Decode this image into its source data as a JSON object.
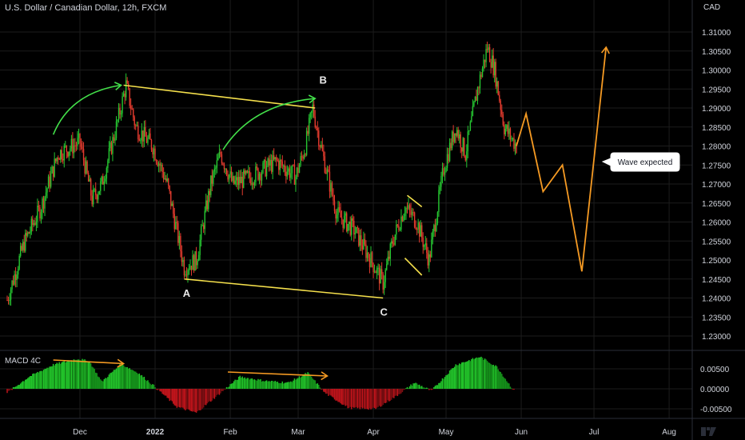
{
  "title": "U.S. Dollar / Canadian Dollar, 12h, FXCM",
  "currency": "CAD",
  "macd_label": "MACD 4C",
  "annotation": "Wave expected",
  "colors": {
    "bg": "#000000",
    "up": "#26c531",
    "down": "#e33b2e",
    "grid": "#1c1c1c",
    "axis_text": "#d1d4dc",
    "yellow": "#f5e04c",
    "green_arc": "#43e04a",
    "orange": "#f59a23",
    "macd_up": "#1fae1f",
    "macd_down": "#b3161b"
  },
  "chart_data": [
    {
      "type": "candlestick",
      "title": "U.S. Dollar / Canadian Dollar, 12h, FXCM",
      "y_unit": "CAD",
      "ylim": [
        1.2265,
        1.3155
      ],
      "y_ticks": [
        "1.31000",
        "1.30500",
        "1.30000",
        "1.29500",
        "1.29000",
        "1.28500",
        "1.28000",
        "1.27500",
        "1.27000",
        "1.26500",
        "1.26000",
        "1.25500",
        "1.25000",
        "1.24500",
        "1.24000",
        "1.23500",
        "1.23000"
      ],
      "x_ticks": [
        "Dec",
        "2022",
        "Feb",
        "Mar",
        "Apr",
        "May",
        "Jun",
        "Jul",
        "Aug"
      ],
      "close_path": [
        [
          "2021-11-01",
          1.2395
        ],
        [
          "2021-11-08",
          1.2545
        ],
        [
          "2021-11-15",
          1.264
        ],
        [
          "2021-11-22",
          1.278
        ],
        [
          "2021-12-01",
          1.281
        ],
        [
          "2021-12-06",
          1.266
        ],
        [
          "2021-12-10",
          1.27
        ],
        [
          "2021-12-16",
          1.285
        ],
        [
          "2021-12-20",
          1.296
        ],
        [
          "2021-12-24",
          1.285
        ],
        [
          "2021-12-31",
          1.28
        ],
        [
          "2022-01-06",
          1.27
        ],
        [
          "2022-01-13",
          1.248
        ],
        [
          "2022-01-18",
          1.25
        ],
        [
          "2022-01-24",
          1.27
        ],
        [
          "2022-01-28",
          1.278
        ],
        [
          "2022-02-02",
          1.27
        ],
        [
          "2022-02-10",
          1.272
        ],
        [
          "2022-02-20",
          1.276
        ],
        [
          "2022-02-28",
          1.272
        ],
        [
          "2022-03-04",
          1.28
        ],
        [
          "2022-03-07",
          1.29
        ],
        [
          "2022-03-11",
          1.278
        ],
        [
          "2022-03-17",
          1.262
        ],
        [
          "2022-03-24",
          1.258
        ],
        [
          "2022-03-31",
          1.25
        ],
        [
          "2022-04-05",
          1.244
        ],
        [
          "2022-04-09",
          1.255
        ],
        [
          "2022-04-14",
          1.264
        ],
        [
          "2022-04-19",
          1.26
        ],
        [
          "2022-04-24",
          1.25
        ],
        [
          "2022-04-30",
          1.274
        ],
        [
          "2022-05-05",
          1.285
        ],
        [
          "2022-05-09",
          1.278
        ],
        [
          "2022-05-14",
          1.295
        ],
        [
          "2022-05-18",
          1.306
        ],
        [
          "2022-05-21",
          1.3
        ],
        [
          "2022-05-25",
          1.285
        ],
        [
          "2022-05-30",
          1.28
        ]
      ]
    },
    {
      "type": "bar",
      "name": "MACD 4C",
      "ylim": [
        -0.0078,
        0.0095
      ],
      "y_ticks": [
        "0.00500",
        "0.00000",
        "-0.00500"
      ],
      "profile": [
        [
          "2021-11-01",
          -0.001
        ],
        [
          "2021-11-10",
          0.003
        ],
        [
          "2021-11-20",
          0.006
        ],
        [
          "2021-11-30",
          0.0075
        ],
        [
          "2021-12-05",
          0.0068
        ],
        [
          "2021-12-10",
          0.0018
        ],
        [
          "2021-12-18",
          0.0062
        ],
        [
          "2021-12-25",
          0.004
        ],
        [
          "2022-01-01",
          0.0005
        ],
        [
          "2022-01-10",
          -0.0045
        ],
        [
          "2022-01-18",
          -0.006
        ],
        [
          "2022-01-28",
          -0.001
        ],
        [
          "2022-02-05",
          0.003
        ],
        [
          "2022-02-15",
          0.002
        ],
        [
          "2022-02-25",
          0.0015
        ],
        [
          "2022-03-05",
          0.004
        ],
        [
          "2022-03-12",
          -0.001
        ],
        [
          "2022-03-22",
          -0.0048
        ],
        [
          "2022-04-02",
          -0.005
        ],
        [
          "2022-04-10",
          -0.002
        ],
        [
          "2022-04-18",
          0.0015
        ],
        [
          "2022-04-25",
          -0.0005
        ],
        [
          "2022-05-05",
          0.006
        ],
        [
          "2022-05-15",
          0.008
        ],
        [
          "2022-05-22",
          0.0055
        ],
        [
          "2022-05-29",
          -0.0005
        ]
      ]
    }
  ],
  "points": [
    {
      "label": "A",
      "date": "2022-01-14",
      "price": 1.245
    },
    {
      "label": "B",
      "date": "2022-03-08",
      "price": 1.2935
    },
    {
      "label": "C",
      "date": "2022-04-06",
      "price": 1.24
    }
  ],
  "projection_path": [
    [
      "2022-05-30",
      1.28
    ],
    [
      "2022-06-03",
      1.2885
    ],
    [
      "2022-06-10",
      1.268
    ],
    [
      "2022-06-18",
      1.275
    ],
    [
      "2022-06-26",
      1.247
    ],
    [
      "2022-07-06",
      1.306
    ]
  ],
  "trendlines": [
    [
      [
        "2021-12-19",
        1.296
      ],
      [
        "2022-03-08",
        1.29
      ]
    ],
    [
      [
        "2022-01-13",
        1.245
      ],
      [
        "2022-04-05",
        1.24
      ]
    ]
  ],
  "arcs": [
    [
      [
        "2021-11-20",
        1.283
      ],
      [
        "2021-11-27",
        1.294
      ],
      [
        "2021-12-18",
        1.296
      ]
    ],
    [
      [
        "2022-01-29",
        1.279
      ],
      [
        "2022-02-10",
        1.291
      ],
      [
        "2022-03-08",
        1.2925
      ]
    ]
  ],
  "wedge": [
    [
      [
        "2022-04-15",
        1.267
      ],
      [
        "2022-04-21",
        1.264
      ]
    ],
    [
      [
        "2022-04-14",
        1.2505
      ],
      [
        "2022-04-21",
        1.246
      ]
    ]
  ],
  "macd_divergences": [
    [
      [
        "2021-11-20",
        0.0072
      ],
      [
        "2022-12-19",
        0.0063
      ]
    ],
    [
      [
        "2022-01-31",
        0.0042
      ],
      [
        "2022-03-13",
        0.0032
      ]
    ]
  ]
}
